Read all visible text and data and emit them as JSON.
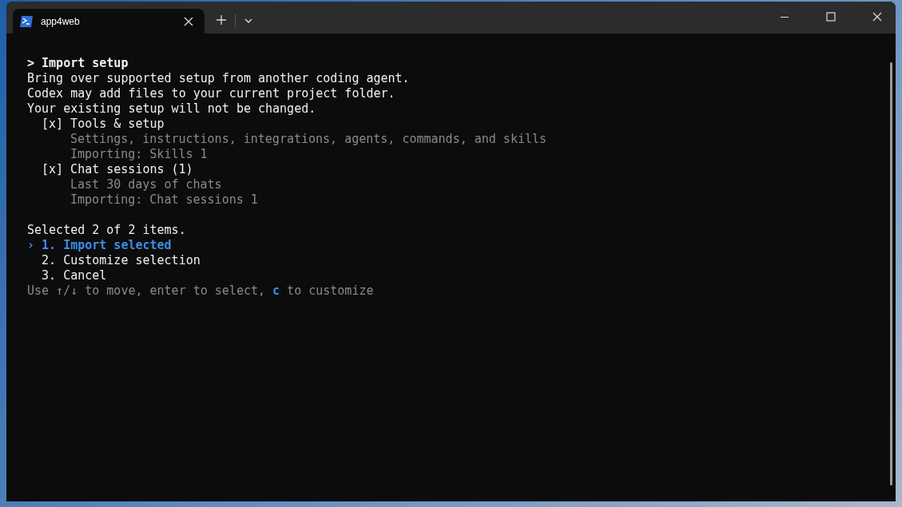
{
  "tab": {
    "title": "app4web",
    "selected": true
  },
  "terminal": {
    "heading": {
      "prompt": ">",
      "text": "Import setup"
    },
    "intro": [
      "Bring over supported setup from another coding agent.",
      "Codex may add files to your current project folder.",
      "Your existing setup will not be changed."
    ],
    "items": [
      {
        "marker": "[x]",
        "label": "Tools & setup",
        "details": [
          "Settings, instructions, integrations, agents, commands, and skills",
          "Importing: Skills 1"
        ]
      },
      {
        "marker": "[x]",
        "label": "Chat sessions (1)",
        "details": [
          "Last 30 days of chats",
          "Importing: Chat sessions 1"
        ]
      }
    ],
    "summary": "Selected 2 of 2 items.",
    "pointer": "›",
    "options": [
      {
        "number": "1.",
        "label": "Import selected",
        "selected": true
      },
      {
        "number": "2.",
        "label": "Customize selection",
        "selected": false
      },
      {
        "number": "3.",
        "label": "Cancel",
        "selected": false
      }
    ],
    "hint": {
      "before": "Use ↑/↓ to move, enter to select,",
      "key": "c",
      "after": "to customize"
    }
  }
}
